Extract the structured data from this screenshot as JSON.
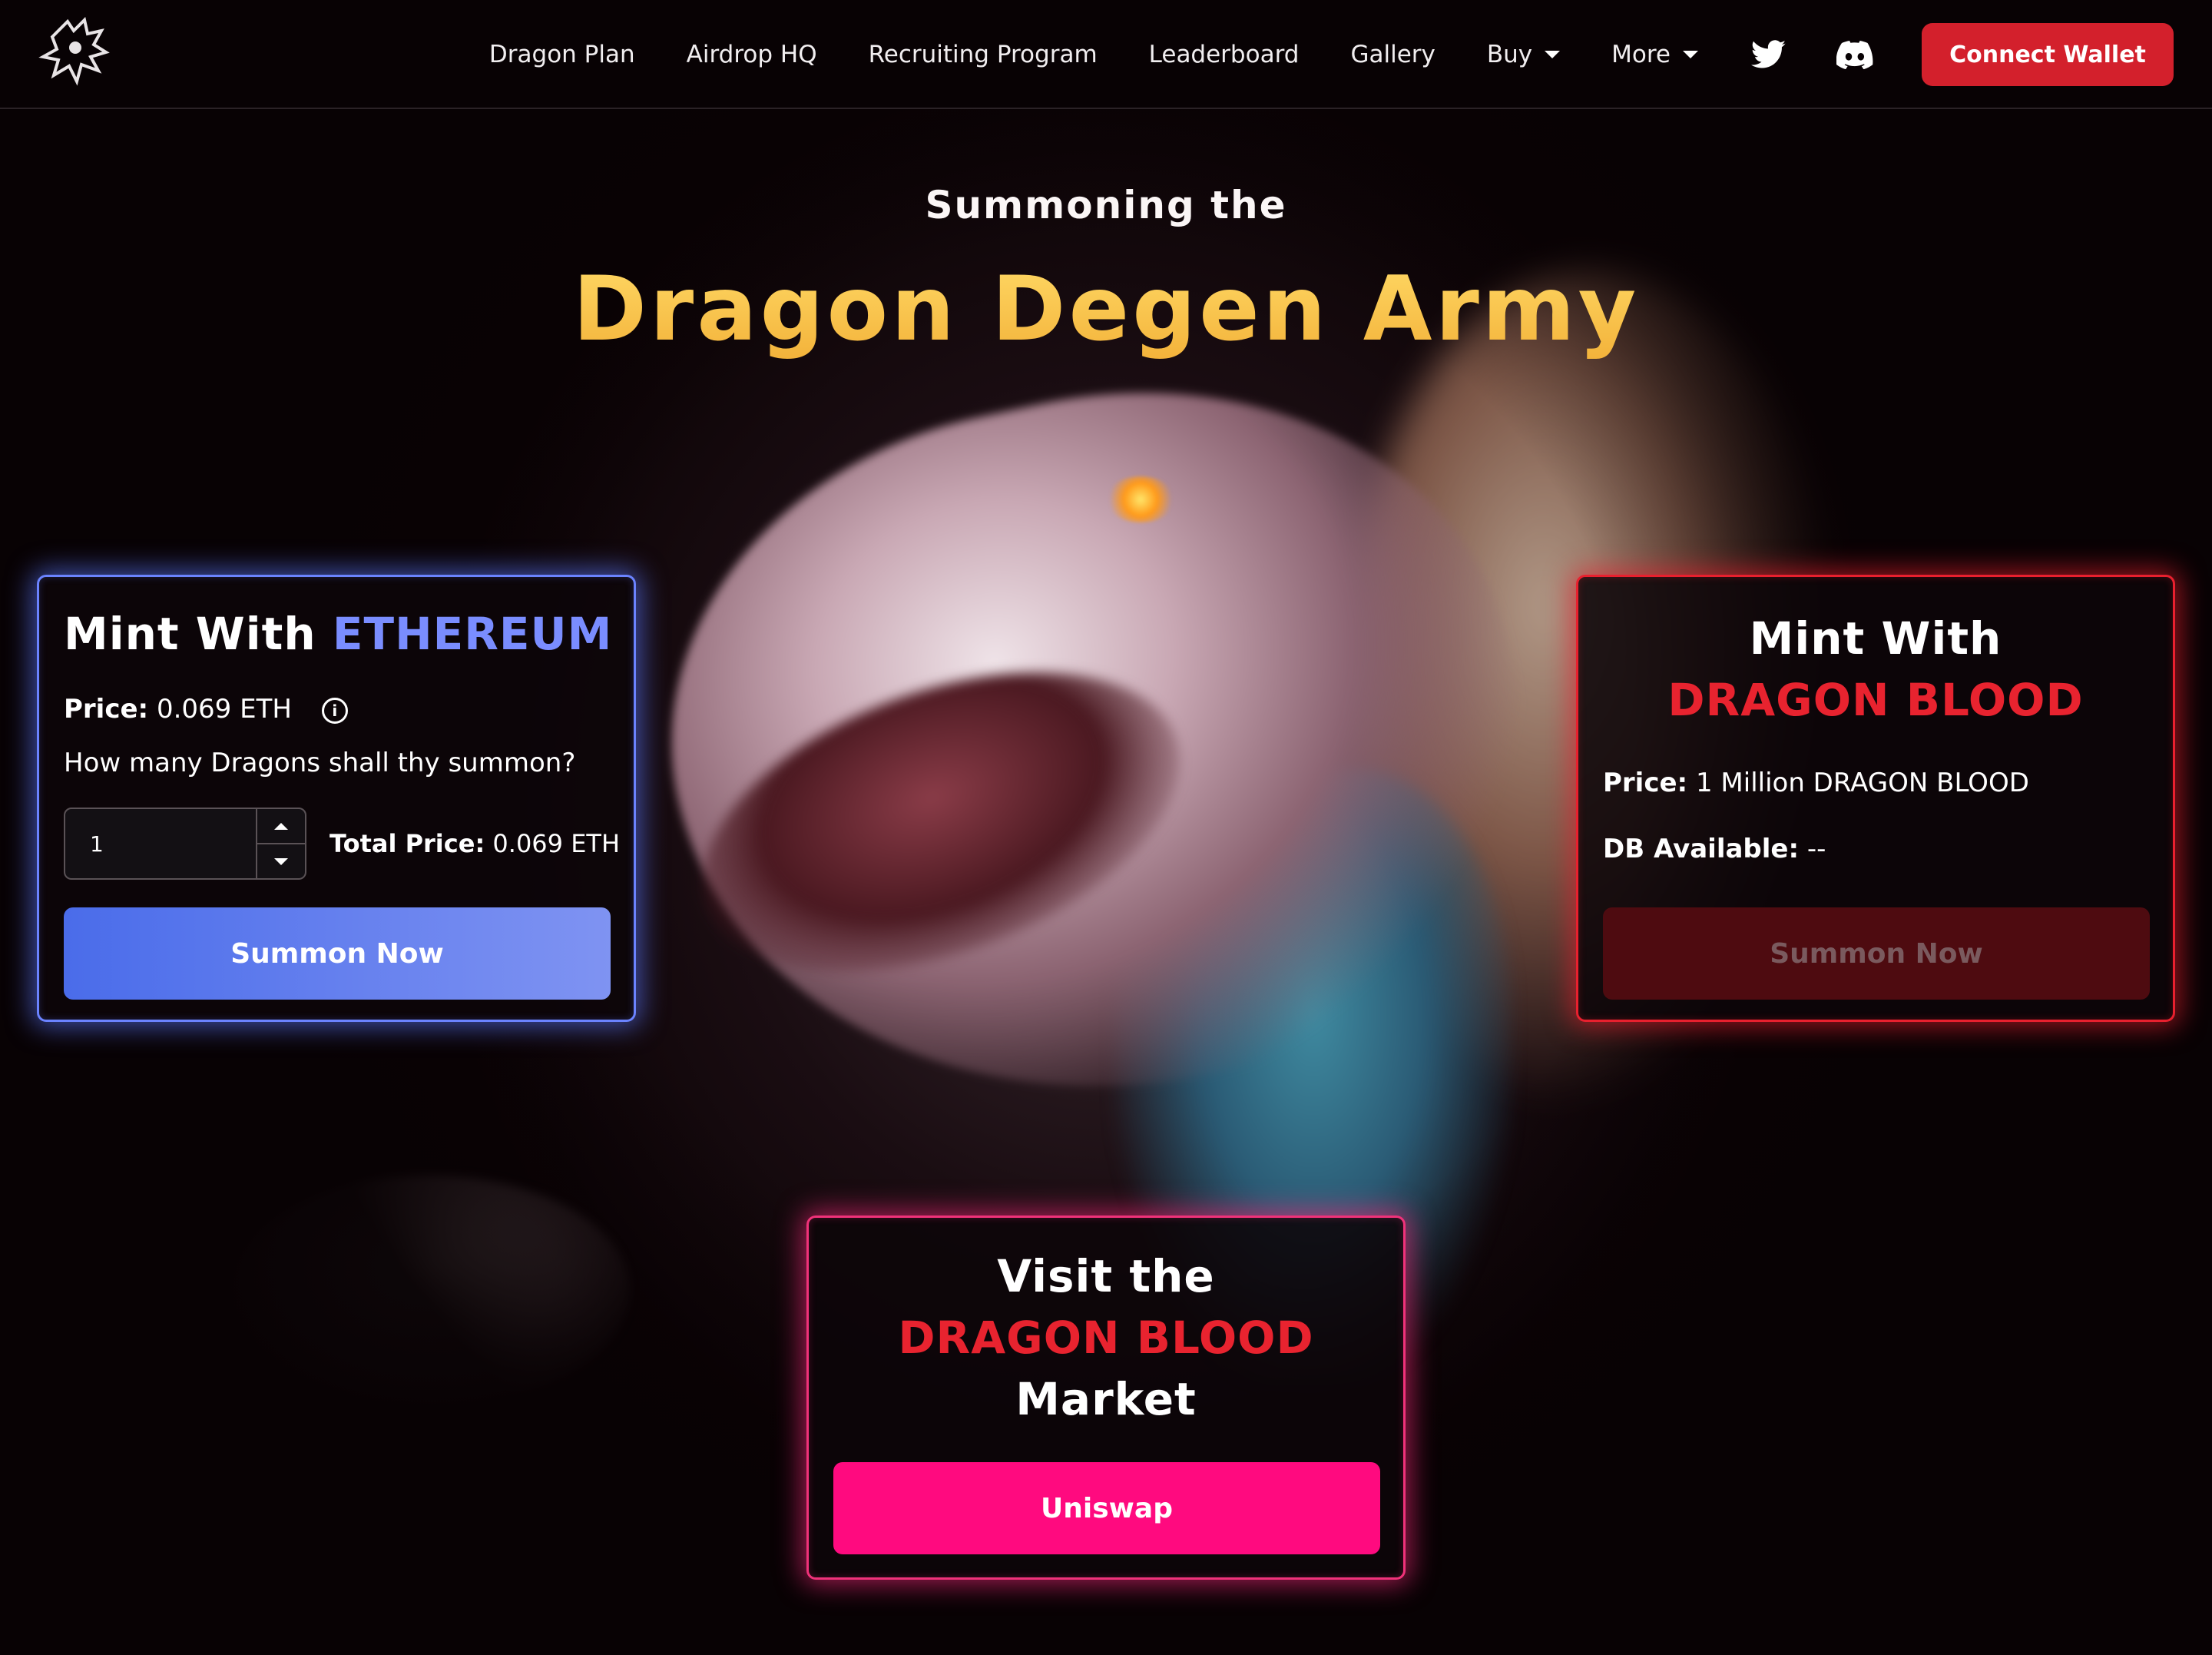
{
  "nav": {
    "logo_icon": "dragon-logo-icon",
    "links": [
      "Dragon Plan",
      "Airdrop HQ",
      "Recruiting Program",
      "Leaderboard",
      "Gallery",
      "Buy",
      "More"
    ],
    "twitter_icon": "twitter-icon",
    "discord_icon": "discord-icon",
    "connect_label": "Connect Wallet",
    "accent_color": "#d3202c"
  },
  "hero": {
    "subtitle": "Summoning the",
    "title": "Dragon Degen Army"
  },
  "eth_card": {
    "heading_prefix": "Mint With",
    "heading_accent": "ETHEREUM",
    "price_label": "Price:",
    "price_value": "0.069 ETH",
    "info_icon": "info-icon",
    "question": "How many Dragons shall thy summon?",
    "quantity": "1",
    "total_label": "Total Price:",
    "total_value": "0.069 ETH",
    "button_label": "Summon Now",
    "accent_color": "#7a8dff"
  },
  "db_card": {
    "heading_prefix": "Mint With",
    "heading_accent": "DRAGON BLOOD",
    "price_label": "Price:",
    "price_value": "1 Million DRAGON BLOOD",
    "available_label": "DB Available:",
    "available_value": "--",
    "button_label": "Summon Now",
    "accent_color": "#e8232f"
  },
  "market_card": {
    "line1": "Visit the",
    "line2": "DRAGON BLOOD",
    "line3": "Market",
    "button_label": "Uniswap",
    "accent_color": "#ff0a7f"
  }
}
